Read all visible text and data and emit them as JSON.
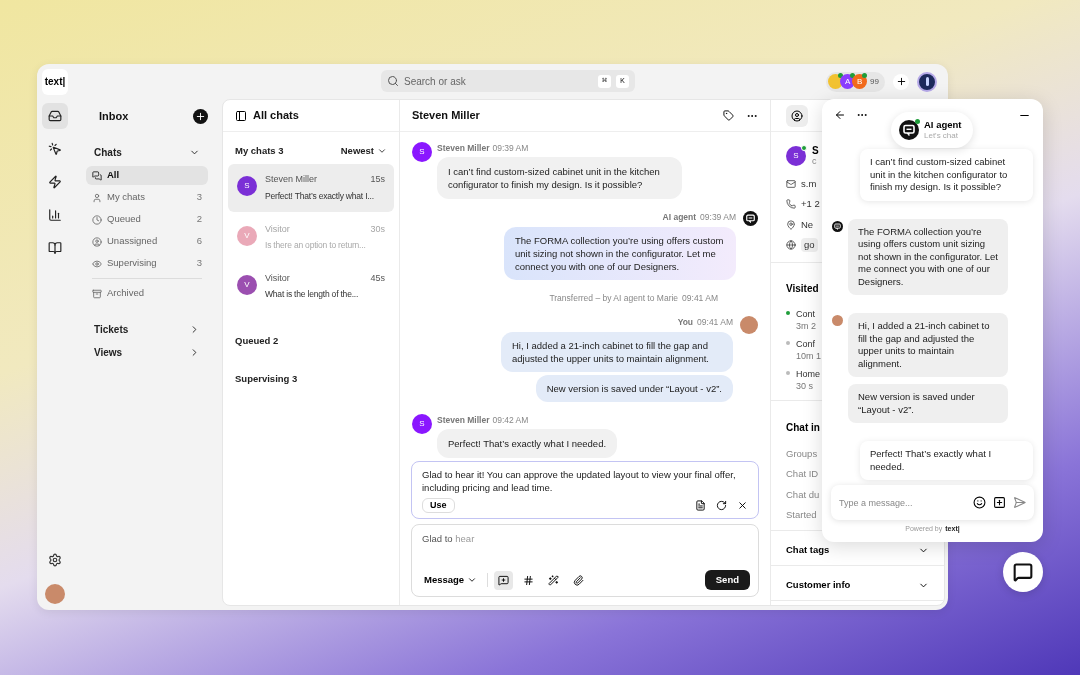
{
  "topbar": {
    "logo": "text|",
    "search": {
      "placeholder": "Search or ask",
      "keys": [
        "⌘",
        "K"
      ]
    },
    "team": {
      "members": [
        {
          "kind": "photo",
          "color": "#f2c230",
          "online": true
        },
        {
          "kind": "initial",
          "initial": "A",
          "color": "#8b3dff",
          "online": true
        },
        {
          "kind": "initial",
          "initial": "B",
          "color": "#f26a1b",
          "online": true
        }
      ],
      "count": "99"
    }
  },
  "rail": {
    "items": [
      {
        "kind": "inbox",
        "selected": true
      },
      {
        "kind": "ai",
        "selected": false
      },
      {
        "kind": "automation",
        "selected": false
      },
      {
        "kind": "reports",
        "selected": false
      },
      {
        "kind": "knowledge",
        "selected": false
      }
    ]
  },
  "nav": {
    "title": "Inbox",
    "sections": [
      {
        "label": "Chats",
        "expanded": true,
        "items": [
          {
            "kind": "all",
            "label": "All",
            "selected": true
          },
          {
            "kind": "mine",
            "label": "My chats",
            "count": "3",
            "selected": false
          },
          {
            "kind": "queued",
            "label": "Queued",
            "count": "2",
            "selected": false
          },
          {
            "kind": "unassigned",
            "label": "Unassigned",
            "count": "6",
            "selected": false
          },
          {
            "kind": "supervising",
            "label": "Supervising",
            "count": "3",
            "selected": false
          },
          {
            "kind": "archived",
            "label": "Archived",
            "selected": false
          }
        ]
      },
      {
        "label": "Tickets",
        "expanded": false
      },
      {
        "label": "Views",
        "expanded": false
      }
    ]
  },
  "chat_list": {
    "title": "All chats",
    "groups": [
      {
        "label": "My chats 3",
        "sort": "Newest",
        "items": [
          {
            "name": "Steven Miller",
            "time": "15s",
            "preview": "Perfect! That’s exactly what I...",
            "initial": "S",
            "color": "#7b2fd6",
            "selected": true,
            "muted": false
          },
          {
            "name": "Visitor",
            "time": "30s",
            "preview": "Is there an option to return...",
            "initial": "V",
            "color": "#eaa9b8",
            "selected": false,
            "muted": true
          },
          {
            "name": "Visitor",
            "time": "45s",
            "preview": "What is the length of the...",
            "initial": "V",
            "color": "#9b4fb0",
            "selected": false,
            "muted": false
          }
        ]
      },
      {
        "label": "Queued 2"
      },
      {
        "label": "Supervising 3"
      }
    ]
  },
  "conversation": {
    "title": "Steven Miller",
    "messages": [
      {
        "kind": "customer",
        "author": "Steven Miller",
        "time": "09:39 AM",
        "initial": "S",
        "texts": [
          "I can’t find custom-sized cabinet unit in the kitchen configurator to finish my design. Is it possible?"
        ]
      },
      {
        "kind": "bot",
        "author": "AI agent",
        "time": "09:39 AM",
        "texts": [
          "The FORMA collection you’re using offers custom unit sizing not shown in the configurator. Let me connect you with one of our Designers."
        ]
      },
      {
        "kind": "system",
        "text": "Transferred – by AI agent to Marie",
        "time": "09:41 AM"
      },
      {
        "kind": "agent",
        "author": "You",
        "time": "09:41 AM",
        "texts": [
          "Hi, I added a 21-inch cabinet to fill the gap and adjusted the upper units to maintain alignment.",
          "New version is saved under “Layout - v2”."
        ]
      },
      {
        "kind": "customer",
        "author": "Steven Miller",
        "time": "09:42 AM",
        "initial": "S",
        "texts": [
          "Perfect! That’s exactly what I needed."
        ]
      }
    ],
    "suggestion": {
      "text": "Glad to hear it! You can approve the updated layout to view your final offer, including pricing and lead time.",
      "use": "Use"
    },
    "composer": {
      "value": "Glad to",
      "completion": "hear",
      "mode": "Message",
      "send": "Send",
      "tools": [
        {
          "kind": "ai-reply",
          "selected": true
        },
        {
          "kind": "hash",
          "selected": false
        },
        {
          "kind": "wand",
          "selected": false
        },
        {
          "kind": "attach",
          "selected": false
        }
      ]
    }
  },
  "details": {
    "name": "S",
    "subtitle": "c",
    "initial": "S",
    "online": true,
    "contacts": [
      {
        "kind": "email",
        "text": "s.m"
      },
      {
        "kind": "phone",
        "text": "+1 2"
      },
      {
        "kind": "location",
        "text": "Ne"
      },
      {
        "kind": "web",
        "text": "go"
      }
    ],
    "visited": {
      "title": "Visited",
      "pages": [
        {
          "title": "Cont",
          "duration": "3m 2",
          "current": true
        },
        {
          "title": "Conf",
          "duration": "10m 1",
          "current": false
        },
        {
          "title": "Home",
          "duration": "30 s",
          "current": false
        }
      ]
    },
    "chat_info": {
      "title": "Chat in",
      "rows": [
        "Groups",
        "Chat ID",
        "Chat du",
        "Started"
      ]
    },
    "sections": [
      {
        "label": "Chat tags",
        "expanded": false
      },
      {
        "label": "Customer info",
        "expanded": false
      }
    ]
  },
  "widget": {
    "agent": {
      "name": "AI agent",
      "status": "Let's chat",
      "online": true
    },
    "messages": [
      {
        "kind": "customer",
        "texts": [
          "I can’t find custom-sized cabinet unit in the kitchen configurator to finish my design. Is it possible?"
        ]
      },
      {
        "kind": "bot",
        "texts": [
          "The FORMA collection you’re using offers custom unit sizing not shown in the configurator. Let me connect you with one of our Designers."
        ]
      },
      {
        "kind": "agent",
        "texts": [
          "Hi, I added a 21-inch cabinet to fill the gap and adjusted the upper units to maintain alignment.",
          "New version is saved under “Layout - v2”."
        ]
      },
      {
        "kind": "customer",
        "texts": [
          "Perfect! That’s exactly what I needed."
        ]
      }
    ],
    "input": {
      "placeholder": "Type a message..."
    },
    "powered": "Powered by",
    "brand": "text|"
  }
}
